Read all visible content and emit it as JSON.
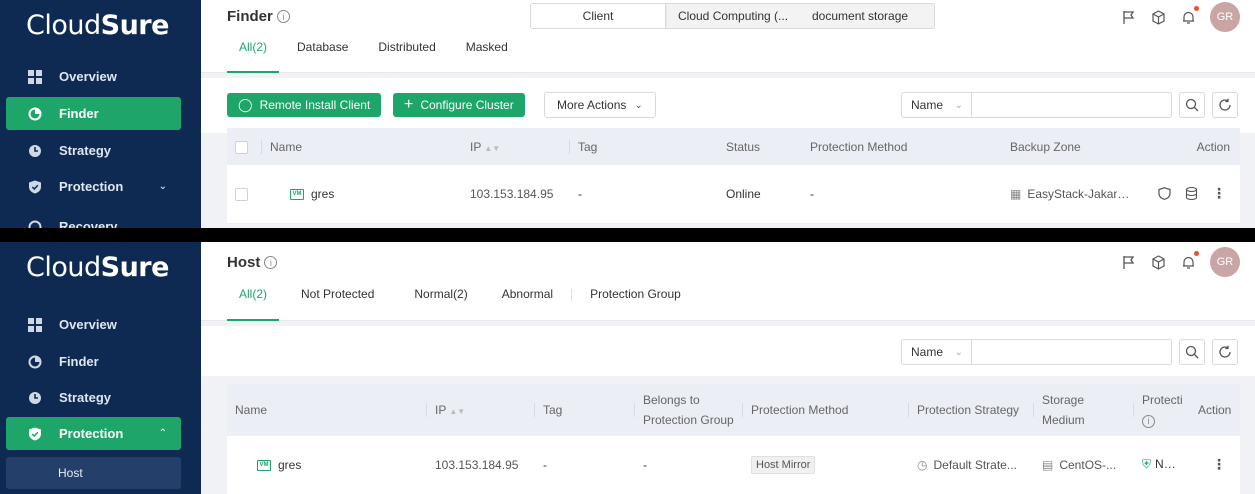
{
  "brand": {
    "logo_prefix": "Cloud",
    "logo_suffix": "Sure"
  },
  "panel1": {
    "sidebar": {
      "items": [
        {
          "label": "Overview",
          "icon": "grid-icon"
        },
        {
          "label": "Finder",
          "icon": "pie-chart-icon",
          "active": true
        },
        {
          "label": "Strategy",
          "icon": "clock-icon"
        },
        {
          "label": "Protection",
          "icon": "shield-icon",
          "chevron": "v"
        },
        {
          "label": "Recovery",
          "icon": "refresh-icon"
        }
      ]
    },
    "header": {
      "title": "Finder",
      "segments": [
        "Client",
        "Cloud Computing (...",
        "document storage"
      ],
      "tabs": [
        "All(2)",
        "Database",
        "Distributed",
        "Masked"
      ],
      "avatar": "GR"
    },
    "toolbar": {
      "remote_install": "Remote Install Client",
      "configure_cluster": "Configure Cluster",
      "more_actions": "More Actions",
      "search_field": "Name",
      "search_placeholder": ""
    },
    "table": {
      "columns": [
        "Name",
        "IP",
        "Tag",
        "Status",
        "Protection Method",
        "Backup Zone",
        "Action"
      ],
      "rows": [
        {
          "vm_badge": "VM",
          "name": "gres",
          "ip": "103.153.184.95",
          "tag": "-",
          "status": "Online",
          "protection_method": "-",
          "backup_zone": "EasyStack-Jakarta-..."
        }
      ]
    }
  },
  "panel2": {
    "sidebar": {
      "items": [
        {
          "label": "Overview",
          "icon": "grid-icon"
        },
        {
          "label": "Finder",
          "icon": "pie-chart-icon"
        },
        {
          "label": "Strategy",
          "icon": "clock-icon"
        },
        {
          "label": "Protection",
          "icon": "shield-icon",
          "active": true,
          "chevron": "^"
        }
      ],
      "sub_item": "Host"
    },
    "header": {
      "title": "Host",
      "tabs": [
        "All(2)",
        "Not Protected",
        "Normal(2)",
        "Abnormal",
        "Protection Group"
      ],
      "avatar": "GR"
    },
    "toolbar": {
      "search_field": "Name",
      "search_placeholder": ""
    },
    "table": {
      "columns": [
        "Name",
        "IP",
        "Tag",
        "Belongs to Protection Group",
        "Protection Method",
        "Protection Strategy",
        "Storage Medium",
        "Protectio...",
        "Action"
      ],
      "rows": [
        {
          "vm_badge": "VM",
          "name": "gres",
          "ip": "103.153.184.95",
          "tag": "-",
          "group": "-",
          "method": "Host Mirror",
          "strategy": "Default Strate...",
          "medium": "CentOS-...",
          "status": "Norm"
        }
      ]
    }
  },
  "colors": {
    "sidebar": "#0e2a52",
    "accent": "#1ea66a",
    "notification_dot": "#e8502f"
  }
}
